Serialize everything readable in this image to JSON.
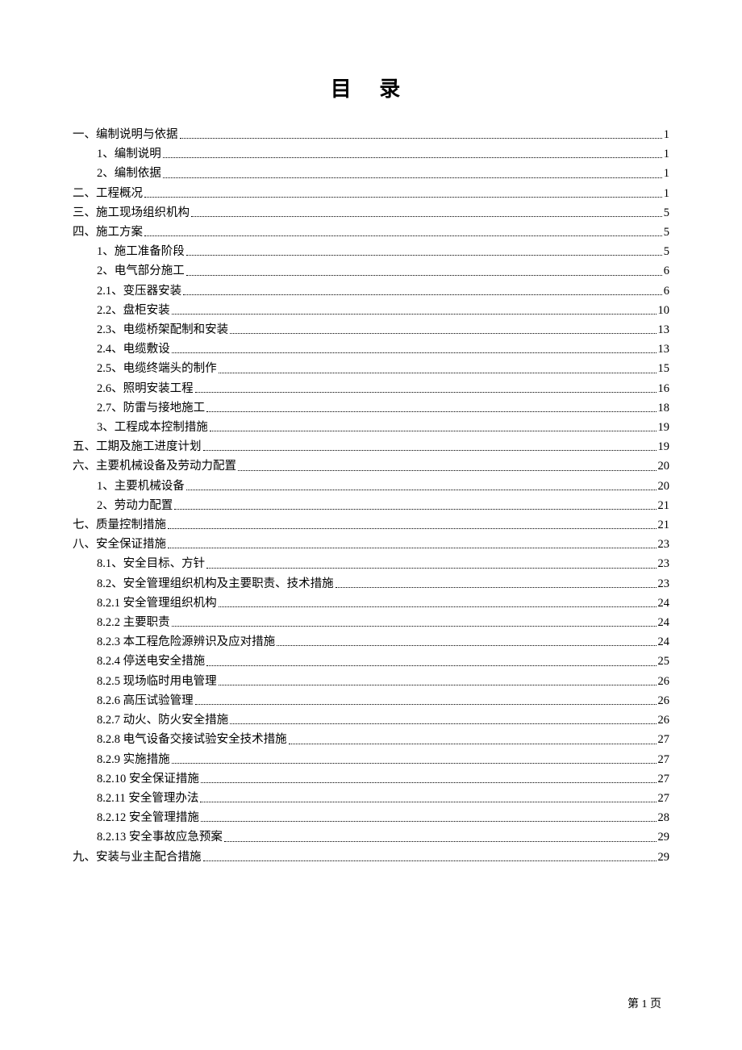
{
  "title": "目 录",
  "page_footer": "第 1 页",
  "toc": [
    {
      "label": "一、编制说明与依据",
      "page": "1",
      "indent": 0
    },
    {
      "label": "1、编制说明",
      "page": "1",
      "indent": 1
    },
    {
      "label": "2、编制依据",
      "page": "1",
      "indent": 1
    },
    {
      "label": "二、工程概况",
      "page": "1",
      "indent": 0
    },
    {
      "label": "三、施工现场组织机构",
      "page": "5",
      "indent": 0
    },
    {
      "label": "四、施工方案",
      "page": "5",
      "indent": 0
    },
    {
      "label": "1、施工准备阶段",
      "page": "5",
      "indent": 1
    },
    {
      "label": "2、电气部分施工",
      "page": "6",
      "indent": 1
    },
    {
      "label": "2.1、变压器安装",
      "page": "6",
      "indent": 1
    },
    {
      "label": "2.2、盘柜安装",
      "page": "10",
      "indent": 1
    },
    {
      "label": "2.3、电缆桥架配制和安装",
      "page": "13",
      "indent": 1
    },
    {
      "label": "2.4、电缆敷设",
      "page": "13",
      "indent": 1
    },
    {
      "label": "2.5、电缆终端头的制作",
      "page": "15",
      "indent": 1
    },
    {
      "label": "2.6、照明安装工程",
      "page": "16",
      "indent": 1
    },
    {
      "label": "2.7、防雷与接地施工",
      "page": "18",
      "indent": 1
    },
    {
      "label": "3、工程成本控制措施",
      "page": "19",
      "indent": 1
    },
    {
      "label": "五、工期及施工进度计划",
      "page": "19",
      "indent": 0
    },
    {
      "label": "六、主要机械设备及劳动力配置",
      "page": "20",
      "indent": 0
    },
    {
      "label": "1、主要机械设备",
      "page": "20",
      "indent": 1
    },
    {
      "label": "2、劳动力配置",
      "page": "21",
      "indent": 1
    },
    {
      "label": "七、质量控制措施",
      "page": "21",
      "indent": 0
    },
    {
      "label": "八、安全保证措施",
      "page": "23",
      "indent": 0
    },
    {
      "label": "8.1、安全目标、方针",
      "page": "23",
      "indent": 1
    },
    {
      "label": "8.2、安全管理组织机构及主要职责、技术措施",
      "page": "23",
      "indent": 1
    },
    {
      "label": "8.2.1 安全管理组织机构",
      "page": "24",
      "indent": 1
    },
    {
      "label": "8.2.2 主要职责",
      "page": "24",
      "indent": 1
    },
    {
      "label": "8.2.3 本工程危险源辨识及应对措施",
      "page": "24",
      "indent": 1
    },
    {
      "label": "8.2.4 停送电安全措施",
      "page": "25",
      "indent": 1
    },
    {
      "label": "8.2.5 现场临时用电管理",
      "page": "26",
      "indent": 1
    },
    {
      "label": "8.2.6 高压试验管理",
      "page": "26",
      "indent": 1
    },
    {
      "label": "8.2.7 动火、防火安全措施",
      "page": "26",
      "indent": 1
    },
    {
      "label": "8.2.8 电气设备交接试验安全技术措施",
      "page": "27",
      "indent": 1
    },
    {
      "label": "8.2.9 实施措施",
      "page": "27",
      "indent": 1
    },
    {
      "label": "8.2.10 安全保证措施",
      "page": "27",
      "indent": 1
    },
    {
      "label": "8.2.11 安全管理办法",
      "page": "27",
      "indent": 1
    },
    {
      "label": "8.2.12 安全管理措施",
      "page": "28",
      "indent": 1
    },
    {
      "label": "8.2.13  安全事故应急预案",
      "page": "29",
      "indent": 1
    },
    {
      "label": "九、安装与业主配合措施",
      "page": "29",
      "indent": 0
    }
  ]
}
